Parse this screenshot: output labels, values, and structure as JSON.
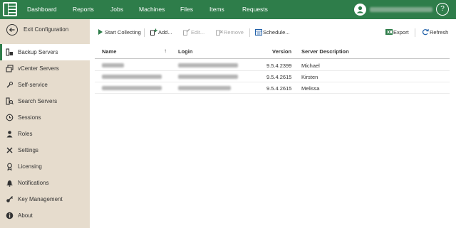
{
  "nav": {
    "items": [
      "Dashboard",
      "Reports",
      "Jobs",
      "Machines",
      "Files",
      "Items",
      "Requests"
    ],
    "help_label": "?"
  },
  "sidebar": {
    "exit_label": "Exit Configuration",
    "items": [
      {
        "label": "Backup Servers",
        "icon": "backup-servers-icon",
        "active": true
      },
      {
        "label": "vCenter Servers",
        "icon": "vcenter-icon"
      },
      {
        "label": "Self-service",
        "icon": "self-service-icon"
      },
      {
        "label": "Search Servers",
        "icon": "search-servers-icon"
      },
      {
        "label": "Sessions",
        "icon": "clock-icon"
      },
      {
        "label": "Roles",
        "icon": "user-icon"
      },
      {
        "label": "Settings",
        "icon": "wrench-icon"
      },
      {
        "label": "Licensing",
        "icon": "license-icon"
      },
      {
        "label": "Notifications",
        "icon": "bell-icon"
      },
      {
        "label": "Key Management",
        "icon": "key-icon"
      },
      {
        "label": "About",
        "icon": "info-icon"
      }
    ]
  },
  "toolbar": {
    "start_collecting": "Start Collecting",
    "add": "Add...",
    "edit": "Edit...",
    "remove": "Remove",
    "schedule": "Schedule...",
    "export": "Export",
    "refresh": "Refresh"
  },
  "table": {
    "columns": [
      "Name",
      "Login",
      "Version",
      "Server Description"
    ],
    "rows": [
      {
        "version": "9.5.4.2399",
        "description": "Michael"
      },
      {
        "version": "9.5.4.2615",
        "description": "Kirsten"
      },
      {
        "version": "9.5.4.2615",
        "description": "Melissa"
      }
    ]
  },
  "colors": {
    "header": "#2e7d4a",
    "sidebar": "#e6dccd",
    "active_accent": "#2e7d4a"
  }
}
